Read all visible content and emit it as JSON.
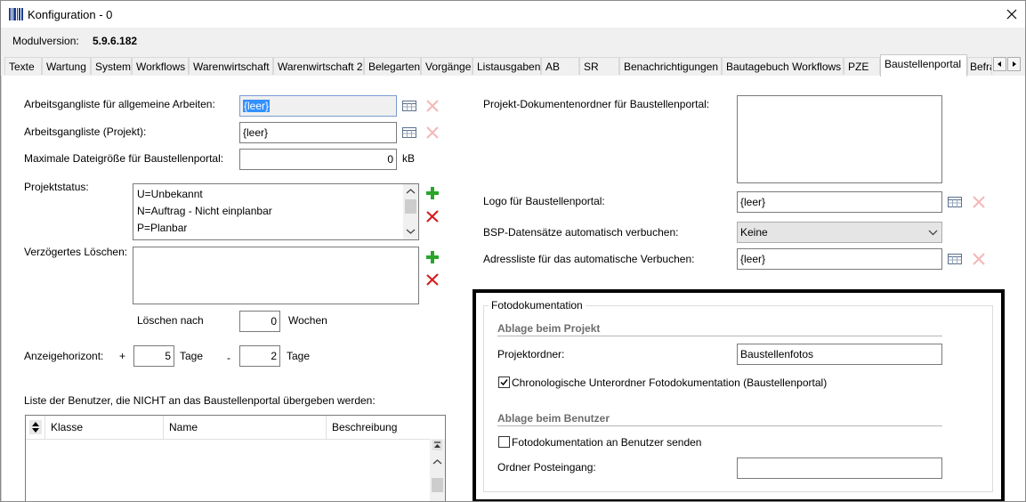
{
  "window": {
    "title": "Konfiguration - 0"
  },
  "modul": {
    "label": "Modulversion:",
    "value": "5.9.6.182"
  },
  "tabs": [
    {
      "label": "Texte"
    },
    {
      "label": "Wartung"
    },
    {
      "label": "System"
    },
    {
      "label": "Workflows"
    },
    {
      "label": "Warenwirtschaft"
    },
    {
      "label": "Warenwirtschaft 2"
    },
    {
      "label": "Belegarten"
    },
    {
      "label": "Vorgänge"
    },
    {
      "label": "Listausgaben"
    },
    {
      "label": "AB"
    },
    {
      "label": "SR"
    },
    {
      "label": "Benachrichtigungen"
    },
    {
      "label": "Bautagebuch Workflows"
    },
    {
      "label": "PZE"
    },
    {
      "label": "Baustellenportal"
    },
    {
      "label": "Befra"
    }
  ],
  "left": {
    "arbeitsgang_allg": {
      "label": "Arbeitsgangliste für allgemeine Arbeiten:",
      "value": "{leer}"
    },
    "arbeitsgang_projekt": {
      "label": "Arbeitsgangliste (Projekt):",
      "value": "{leer}"
    },
    "max_datei": {
      "label": "Maximale Dateigröße für Baustellenportal:",
      "value": "0",
      "unit": "kB"
    },
    "projektstatus": {
      "label": "Projektstatus:",
      "items": [
        "U=Unbekannt",
        "N=Auftrag - Nicht einplanbar",
        "P=Planbar"
      ]
    },
    "verzoegert": {
      "label": "Verzögertes Löschen:"
    },
    "loeschen_nach": {
      "label": "Löschen nach",
      "value": "0",
      "unit": "Wochen"
    },
    "anzeigehorizont": {
      "label": "Anzeigehorizont:",
      "plus": "+",
      "value1": "5",
      "unit1": "Tage",
      "minus": "-",
      "value2": "2",
      "unit2": "Tage"
    },
    "benutzerliste": {
      "label": "Liste der Benutzer, die NICHT an das Baustellenportal übergeben werden:",
      "columns": [
        "Klasse",
        "Name",
        "Beschreibung"
      ]
    }
  },
  "right": {
    "dokumentenordner": {
      "label": "Projekt-Dokumentenordner für Baustellenportal:"
    },
    "logo": {
      "label": "Logo für Baustellenportal:",
      "value": "{leer}"
    },
    "bsp": {
      "label": "BSP-Datensätze automatisch verbuchen:",
      "value": "Keine"
    },
    "adressliste": {
      "label": "Adressliste für das automatische Verbuchen:",
      "value": "{leer}"
    },
    "foto": {
      "title": "Fotodokumentation",
      "projekt_section": "Ablage beim Projekt",
      "projektordner_label": "Projektordner:",
      "projektordner_value": "Baustellenfotos",
      "chrono_label": "Chronologische Unterordner Fotodokumentation (Baustellenportal)",
      "chrono_checked": true,
      "benutzer_section": "Ablage beim Benutzer",
      "senden_label": "Fotodokumentation an Benutzer senden",
      "senden_checked": false,
      "posteingang_label": "Ordner Posteingang:",
      "posteingang_value": ""
    }
  },
  "colors": {
    "add": "#2aa52a",
    "delete": "#d32020",
    "delete_disabled": "#f2b8b8",
    "selection": "#3390ff",
    "highlight_frame": "#000000"
  },
  "icons": {
    "app": "barcode-icon",
    "close": "close-icon",
    "table": "table-icon",
    "add": "plus-icon",
    "delete": "x-icon"
  }
}
